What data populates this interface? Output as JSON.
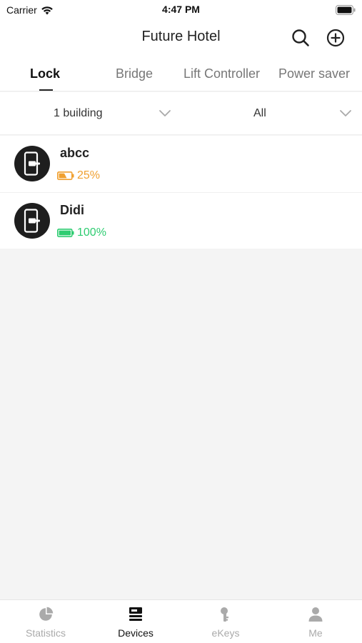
{
  "status_bar": {
    "carrier": "Carrier",
    "time": "4:47 PM"
  },
  "header": {
    "title": "Future Hotel"
  },
  "tabs": [
    {
      "label": "Lock",
      "active": true
    },
    {
      "label": "Bridge",
      "active": false
    },
    {
      "label": "Lift Controller",
      "active": false
    },
    {
      "label": "Power saver",
      "active": false
    }
  ],
  "filters": {
    "building": "1 building",
    "status": "All"
  },
  "devices": [
    {
      "name": "abcc",
      "battery": "25%",
      "battery_level": 0.25,
      "battery_color": "#f0a030"
    },
    {
      "name": "Didi",
      "battery": "100%",
      "battery_level": 1.0,
      "battery_color": "#2ecc71"
    }
  ],
  "bottom_nav": [
    {
      "label": "Statistics",
      "icon": "pie-chart-icon",
      "active": false
    },
    {
      "label": "Devices",
      "icon": "devices-icon",
      "active": true
    },
    {
      "label": "eKeys",
      "icon": "key-icon",
      "active": false
    },
    {
      "label": "Me",
      "icon": "person-icon",
      "active": false
    }
  ],
  "colors": {
    "active_text": "#111111",
    "inactive_text": "#aaaaaa",
    "battery_low": "#f0a030",
    "battery_full": "#2ecc71"
  }
}
